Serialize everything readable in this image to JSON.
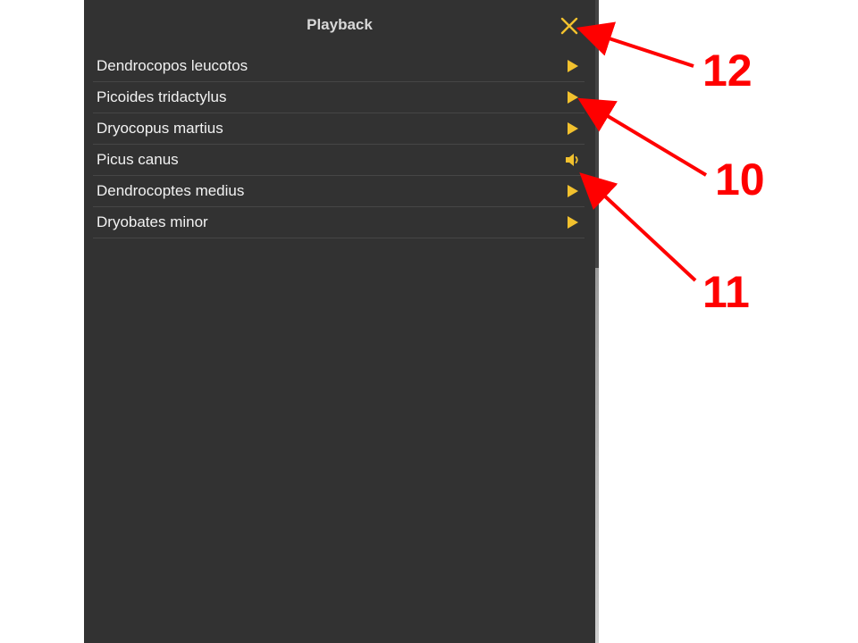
{
  "panel": {
    "title": "Playback",
    "close_icon": "close-icon",
    "accent_color": "#f2c12e",
    "background_color": "#323232"
  },
  "items": [
    {
      "label": "Dendrocopos leucotos",
      "icon": "play-icon"
    },
    {
      "label": "Picoides tridactylus",
      "icon": "play-icon"
    },
    {
      "label": "Dryocopus martius",
      "icon": "play-icon"
    },
    {
      "label": "Picus canus",
      "icon": "speaker-icon"
    },
    {
      "label": "Dendrocoptes medius",
      "icon": "play-icon"
    },
    {
      "label": "Dryobates minor",
      "icon": "play-icon"
    }
  ],
  "annotations": [
    {
      "number": "12",
      "color": "#ff0000"
    },
    {
      "number": "10",
      "color": "#ff0000"
    },
    {
      "number": "11",
      "color": "#ff0000"
    }
  ]
}
